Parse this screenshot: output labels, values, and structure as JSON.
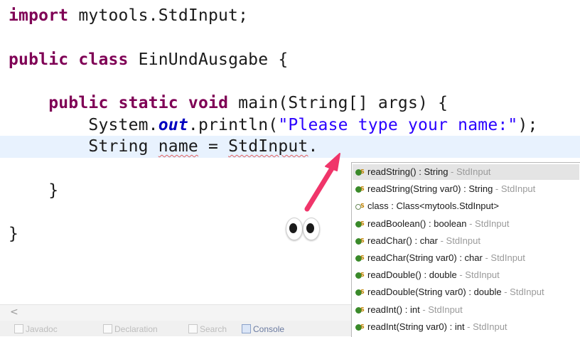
{
  "code": {
    "line1": {
      "keyword": "import",
      "rest": " mytools.StdInput;"
    },
    "line2": {
      "kw1": "public",
      "kw2": "class",
      "rest": " EinUndAusgabe {"
    },
    "line3": {
      "indent": "    ",
      "kw1": "public",
      "kw2": "static",
      "kw3": "void",
      "rest": " main(String[] args) {"
    },
    "line4": {
      "indent": "        ",
      "pre": "System.",
      "field": "out",
      "mid": ".println(",
      "string": "\"Please type your name:\"",
      "post": ");"
    },
    "line5": {
      "indent": "        ",
      "type": "String ",
      "var": "name",
      "mid": " = ",
      "cls": "StdInput",
      "dot": "."
    },
    "line6": "    }",
    "line7": "}"
  },
  "scrollbar": {
    "left_arrow": "<"
  },
  "bottom_tabs": [
    "Javadoc",
    "Declaration",
    "Search",
    "Console"
  ],
  "autocomplete": {
    "items": [
      {
        "sig": "readString() : String",
        "owner": " - StdInput",
        "icon": "public-static-method-icon",
        "selected": true
      },
      {
        "sig": "readString(String var0) : String",
        "owner": " - StdInput",
        "icon": "public-static-method-icon",
        "selected": false
      },
      {
        "sig": "class : Class<mytools.StdInput>",
        "owner": "",
        "icon": "class-literal-icon",
        "selected": false
      },
      {
        "sig": "readBoolean() : boolean",
        "owner": " - StdInput",
        "icon": "public-static-method-icon",
        "selected": false
      },
      {
        "sig": "readChar() : char",
        "owner": " - StdInput",
        "icon": "public-static-method-icon",
        "selected": false
      },
      {
        "sig": "readChar(String var0) : char",
        "owner": " - StdInput",
        "icon": "public-static-method-icon",
        "selected": false
      },
      {
        "sig": "readDouble() : double",
        "owner": " - StdInput",
        "icon": "public-static-method-icon",
        "selected": false
      },
      {
        "sig": "readDouble(String var0) : double",
        "owner": " - StdInput",
        "icon": "public-static-method-icon",
        "selected": false
      },
      {
        "sig": "readInt() : int",
        "owner": " - StdInput",
        "icon": "public-static-method-icon",
        "selected": false
      },
      {
        "sig": "readInt(String var0) : int",
        "owner": " - StdInput",
        "icon": "public-static-method-icon",
        "selected": false
      }
    ]
  },
  "colors": {
    "keyword": "#7f0055",
    "string": "#2a00ff",
    "field": "#0000c0",
    "current_line": "#e8f2fe",
    "method_icon": "#3a8a2a",
    "arrow": "#f0356a"
  }
}
